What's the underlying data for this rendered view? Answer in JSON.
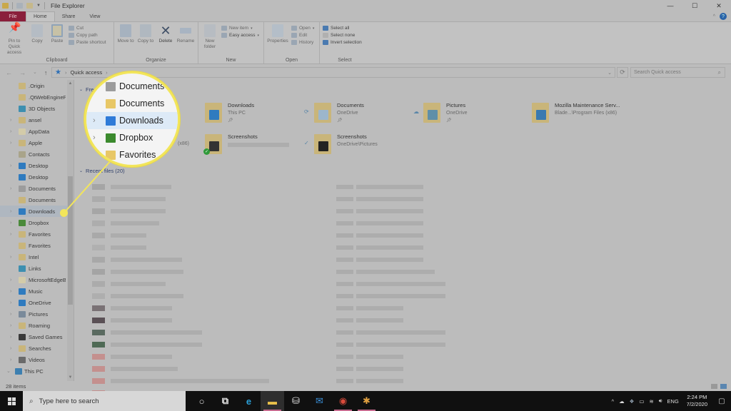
{
  "window": {
    "title": "File Explorer",
    "controls": {
      "minimize": "—",
      "maximize": "☐",
      "close": "✕"
    }
  },
  "tabs": [
    {
      "label": "File"
    },
    {
      "label": "Home"
    },
    {
      "label": "Share"
    },
    {
      "label": "View"
    }
  ],
  "help_icon": "?",
  "ribbon": {
    "clipboard": {
      "label": "Clipboard",
      "pin": "Pin to Quick access",
      "copy": "Copy",
      "paste": "Paste",
      "cut": "Cut",
      "copy_path": "Copy path",
      "paste_shortcut": "Paste shortcut"
    },
    "organize": {
      "label": "Organize",
      "move_to": "Move to",
      "copy_to": "Copy to",
      "delete": "Delete",
      "rename": "Rename"
    },
    "new": {
      "label": "New",
      "new_folder": "New folder",
      "new_item": "New item",
      "easy_access": "Easy access"
    },
    "open": {
      "label": "Open",
      "properties": "Properties",
      "open": "Open",
      "edit": "Edit",
      "history": "History"
    },
    "select": {
      "label": "Select",
      "select_all": "Select all",
      "select_none": "Select none",
      "invert": "Invert selection"
    }
  },
  "address": {
    "back": "←",
    "forward": "→",
    "recent": "⌄",
    "up": "↑",
    "location": "Quick access",
    "search_placeholder": "Search Quick access"
  },
  "sidebar": {
    "items": [
      {
        "label": ".Origin",
        "chevron": "",
        "color": "#c9b57a"
      },
      {
        "label": ".QtWebEngineP",
        "chevron": "",
        "color": "#c9b57a"
      },
      {
        "label": "3D Objects",
        "chevron": "",
        "color": "#3d8fb0"
      },
      {
        "label": "ansel",
        "chevron": "›",
        "color": "#c9b57a"
      },
      {
        "label": "AppData",
        "chevron": "›",
        "color": "#d3cba9"
      },
      {
        "label": "Apple",
        "chevron": "›",
        "color": "#c9b57a"
      },
      {
        "label": "Contacts",
        "chevron": "",
        "color": "#a9a48a"
      },
      {
        "label": "Desktop",
        "chevron": "›",
        "color": "#2f7bbf"
      },
      {
        "label": "Desktop",
        "chevron": "",
        "color": "#2f7bbf"
      },
      {
        "label": "Documents",
        "chevron": "›",
        "color": "#9c9c9c"
      },
      {
        "label": "Documents",
        "chevron": "",
        "color": "#c9b57a"
      },
      {
        "label": "Downloads",
        "chevron": "›",
        "color": "#2f7bbf",
        "selected": true
      },
      {
        "label": "Dropbox",
        "chevron": "›",
        "color": "#4a8a3a"
      },
      {
        "label": "Favorites",
        "chevron": "›",
        "color": "#c9b57a"
      },
      {
        "label": "Favorites",
        "chevron": "",
        "color": "#c9b57a"
      },
      {
        "label": "Intel",
        "chevron": "›",
        "color": "#c9b57a"
      },
      {
        "label": "Links",
        "chevron": "",
        "color": "#3d8fb0"
      },
      {
        "label": "MicrosoftEdgeB",
        "chevron": "›",
        "color": "#d3cba9"
      },
      {
        "label": "Music",
        "chevron": "›",
        "color": "#2f7bbf"
      },
      {
        "label": "OneDrive",
        "chevron": "›",
        "color": "#2f7bbf"
      },
      {
        "label": "Pictures",
        "chevron": "›",
        "color": "#7a8a9a"
      },
      {
        "label": "Roaming",
        "chevron": "›",
        "color": "#c9b57a"
      },
      {
        "label": "Saved Games",
        "chevron": "›",
        "color": "#3a3a3a"
      },
      {
        "label": "Searches",
        "chevron": "›",
        "color": "#c9b57a"
      },
      {
        "label": "Videos",
        "chevron": "›",
        "color": "#6a6a6a"
      }
    ],
    "this_pc": "This PC"
  },
  "frequent": {
    "heading": "Frequent folders",
    "tiles": [
      {
        "name": "Downloads",
        "sub": "This PC",
        "pinned": true,
        "status": "",
        "overlay": "#2f7bbf"
      },
      {
        "name": "Documents",
        "sub": "OneDrive",
        "pinned": true,
        "status": "⟳",
        "overlay": "#9cb6cc"
      },
      {
        "name": "Pictures",
        "sub": "OneDrive",
        "pinned": true,
        "status": "☁",
        "overlay": "#5f8fa8"
      },
      {
        "name": "Mozilla Maintenance Serv...",
        "sub": "Blade...\\Program Files (x86)",
        "pinned": false,
        "status": "",
        "overlay": "#3a7ab0"
      },
      {
        "name": "Screenshots",
        "sub": "",
        "pinned": false,
        "status": "",
        "overlay": "#333333"
      },
      {
        "name": "Screenshots",
        "sub": "OneDrive\\Pictures",
        "pinned": false,
        "status": "✓",
        "overlay": "#222222"
      }
    ],
    "partial_sub": "(x86)"
  },
  "recent": {
    "heading": "Recent files (20)",
    "row_count": 20,
    "swatches": [
      "#a5a5a5",
      "#ababab",
      "#a6a6a6",
      "#adadad",
      "#a9a9a9",
      "#b0b0b0",
      "#a8a8a8",
      "#a4a4a4",
      "#ababab",
      "#aeaeae",
      "#7a7275",
      "#5a5055",
      "#5a6a60",
      "#4f6a55",
      "#c4908e",
      "#c4908e",
      "#c4908e",
      "#c4908e",
      "#c89290",
      "#c89290"
    ]
  },
  "status_bar": {
    "item_count": "28 items"
  },
  "magnifier": {
    "items": [
      {
        "label": "Documents",
        "chevron": "",
        "color": "#9c9c9c"
      },
      {
        "label": "Documents",
        "chevron": "",
        "color": "#e8c766"
      },
      {
        "label": "Downloads",
        "chevron": "›",
        "color": "#2f7bd8",
        "selected": true
      },
      {
        "label": "Dropbox",
        "chevron": "›",
        "color": "#3b8a2e"
      },
      {
        "label": "Favorites",
        "chevron": "",
        "color": "#e8c766"
      }
    ],
    "accent": "#f2e55b"
  },
  "taskbar": {
    "search_placeholder": "Type here to search",
    "apps": [
      {
        "name": "cortana",
        "glyph": "○",
        "color": "#e0e0e0"
      },
      {
        "name": "task-view",
        "glyph": "⧉",
        "color": "#e0e0e0"
      },
      {
        "name": "edge",
        "glyph": "e",
        "color": "#2aa0d8"
      },
      {
        "name": "file-explorer",
        "glyph": "▬",
        "color": "#e8c04a",
        "active": true
      },
      {
        "name": "store",
        "glyph": "⛁",
        "color": "#e8e8e8"
      },
      {
        "name": "mail",
        "glyph": "✉",
        "color": "#3a8fd8"
      },
      {
        "name": "chrome",
        "glyph": "◉",
        "color": "#d94a3a",
        "running": true
      },
      {
        "name": "slack",
        "glyph": "✱",
        "color": "#e0a040",
        "running": true
      }
    ],
    "tray": {
      "chevron": "^",
      "language": "ENG",
      "time": "2:24 PM",
      "date": "7/2/2020"
    }
  }
}
